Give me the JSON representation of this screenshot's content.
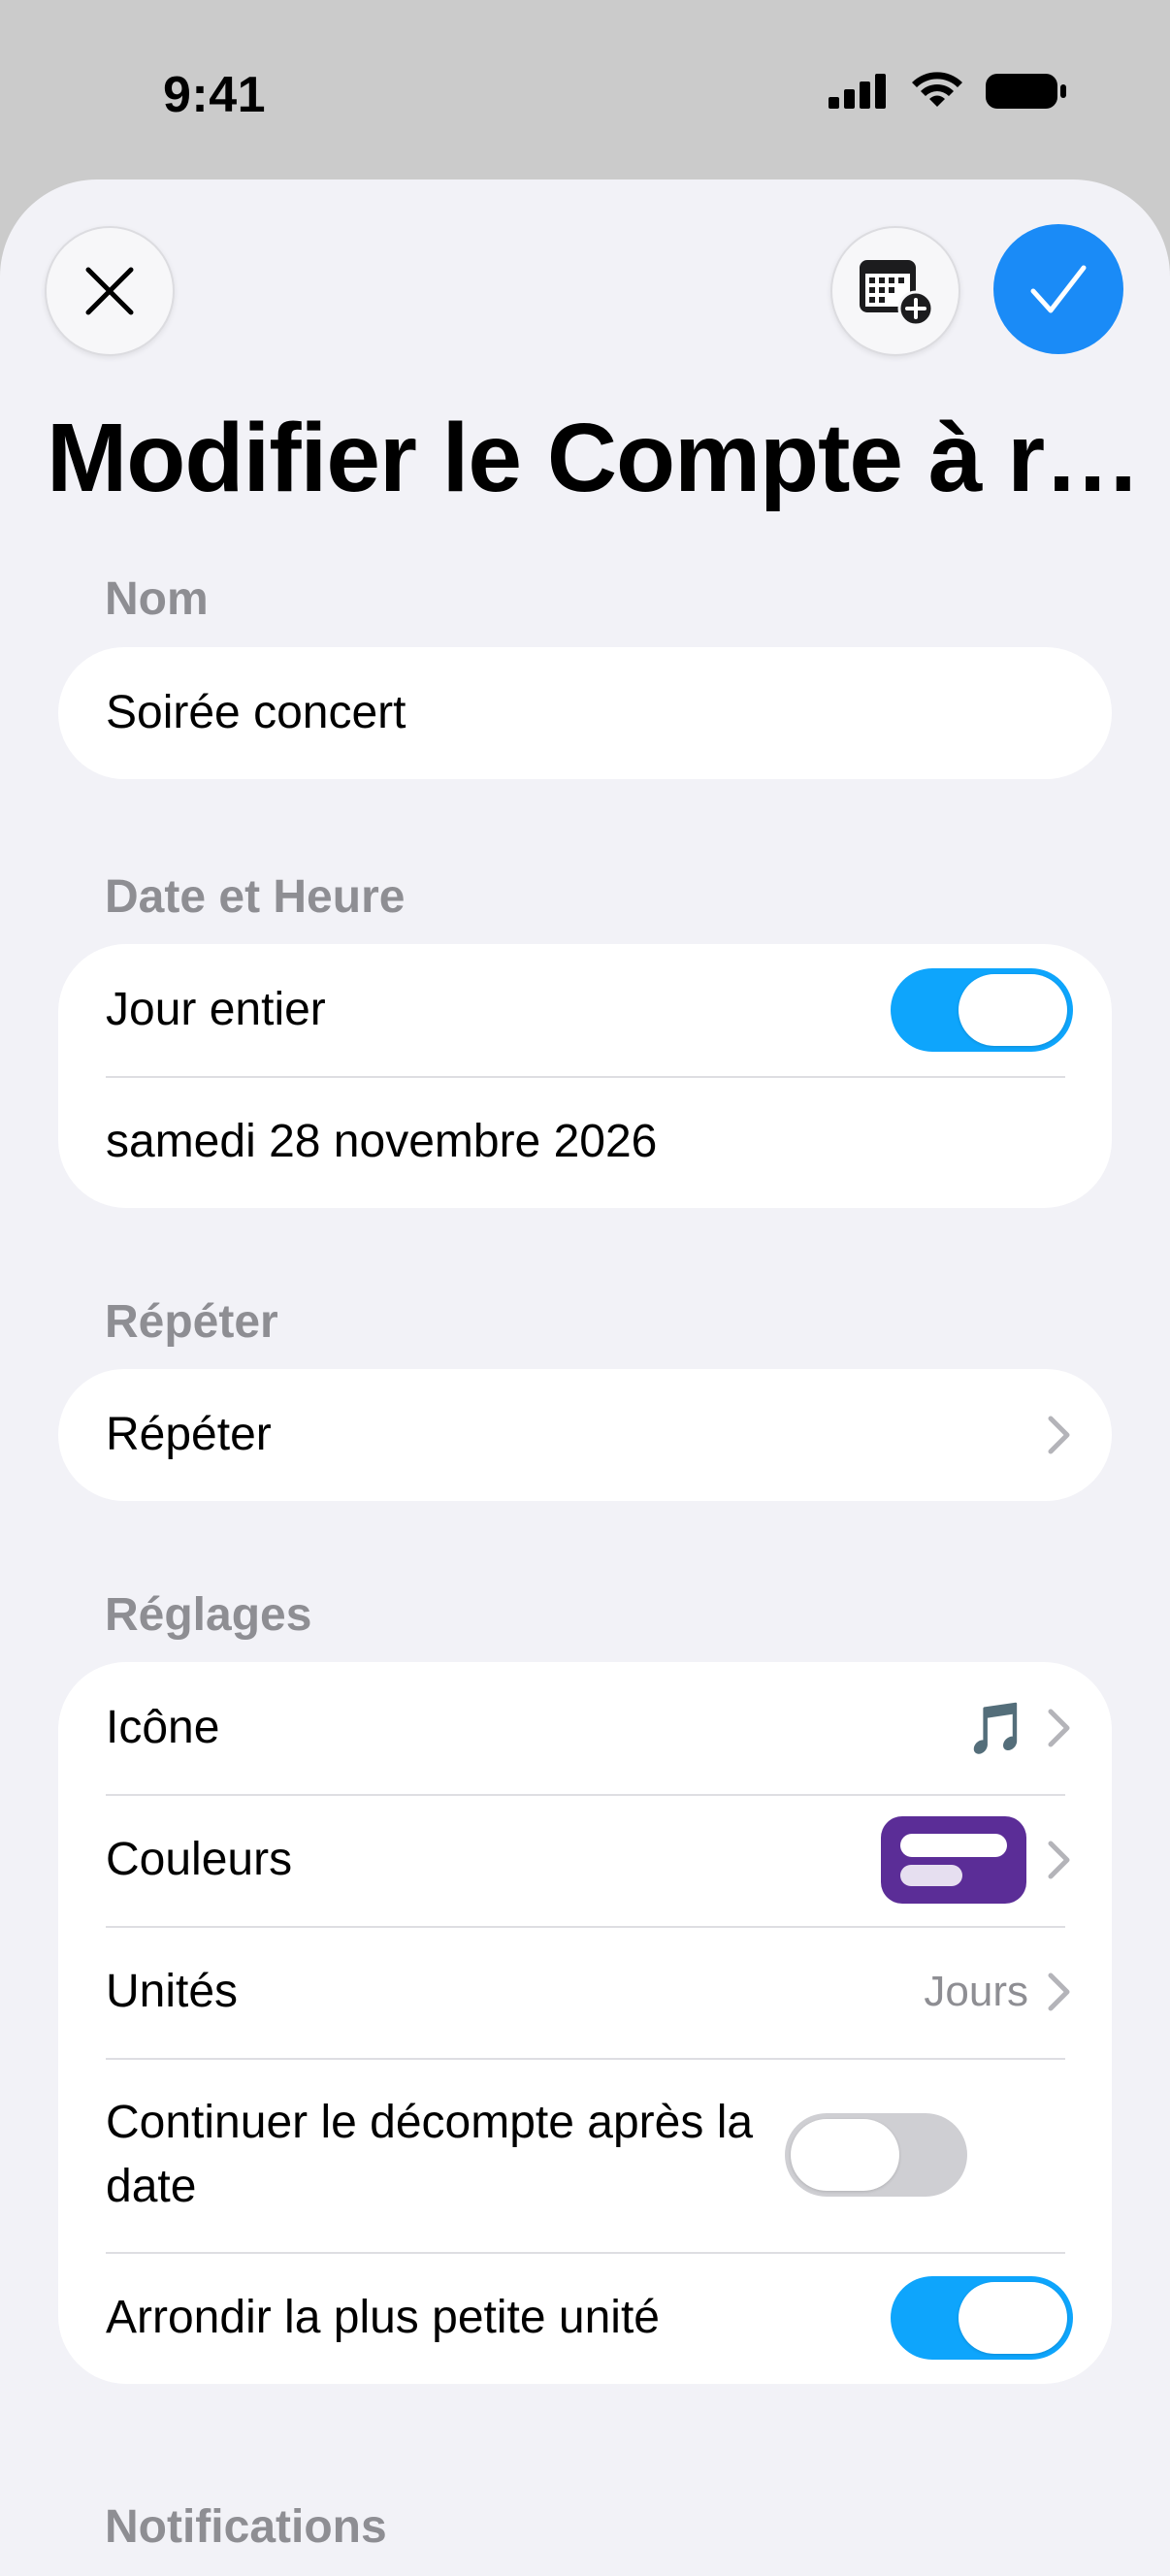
{
  "status_bar": {
    "time": "9:41"
  },
  "header": {
    "title": "Modifier le Compte à r…",
    "close_icon": "close-icon",
    "calendar_icon": "calendar-add-icon",
    "confirm_icon": "checkmark-icon",
    "accent": "#1a8bf7"
  },
  "sections": {
    "name": {
      "label": "Nom",
      "value": "Soirée concert"
    },
    "datetime": {
      "label": "Date et Heure",
      "all_day_label": "Jour entier",
      "all_day_on": true,
      "date": "samedi 28 novembre 2026"
    },
    "repeat": {
      "label": "Répéter",
      "row_label": "Répéter"
    },
    "settings": {
      "label": "Réglages",
      "icon_label": "Icône",
      "icon_value": "🎵",
      "colors_label": "Couleurs",
      "color_swatch": "#5b2d97",
      "units_label": "Unités",
      "units_value": "Jours",
      "continue_label": "Continuer le décompte après la date",
      "continue_on": false,
      "round_label": "Arrondir la plus petite unité",
      "round_on": true
    },
    "notifications": {
      "label": "Notifications"
    }
  }
}
